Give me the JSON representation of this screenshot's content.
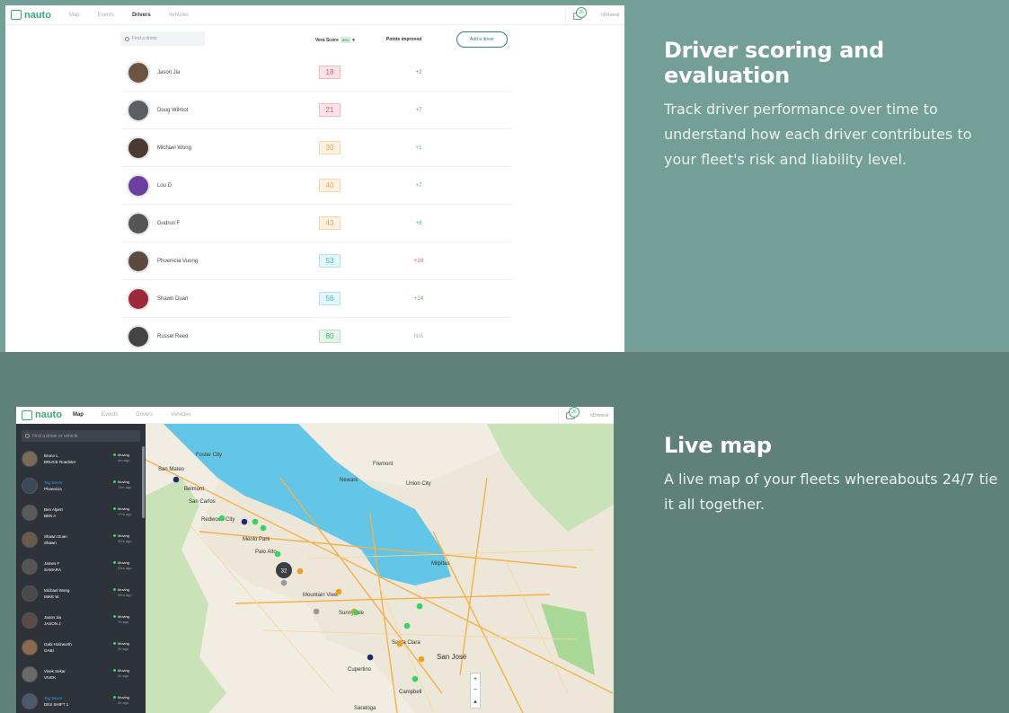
{
  "section1": {
    "heading": "Driver scoring and evaluation",
    "body": "Track driver performance over time to understand how each driver contributes to your fleet's risk and liability level."
  },
  "section2": {
    "heading": "Live map",
    "body": "A live map of your fleets whereabouts 24/7 tie it all together."
  },
  "app": {
    "logo": "nauto",
    "nav": [
      "Map",
      "Events",
      "Drivers",
      "Vehicles"
    ],
    "notification_count": "26",
    "user": "nDriveral"
  },
  "drivers_view": {
    "active_nav": "Drivers",
    "search_placeholder": "Find a driver",
    "col_score": "Vera Score",
    "col_score_badge": "80%",
    "col_points": "Points improved",
    "add_button": "Add a driver",
    "drivers": [
      {
        "name": "Jason Jia",
        "score": "18",
        "points": "+2",
        "tone": "red"
      },
      {
        "name": "Doug Wilmot",
        "score": "21",
        "points": "+7",
        "tone": "red"
      },
      {
        "name": "Michael Wong",
        "score": "30",
        "points": "+1",
        "tone": "orange"
      },
      {
        "name": "Lou D",
        "score": "40",
        "points": "+7",
        "tone": "orange"
      },
      {
        "name": "Gudrun F",
        "score": "43",
        "points": "+8",
        "tone": "orange"
      },
      {
        "name": "Phoenicia Vuong",
        "score": "53",
        "points": "+19",
        "tone": "blue"
      },
      {
        "name": "Shawn Duan",
        "score": "56",
        "points": "+14",
        "tone": "blue"
      },
      {
        "name": "Russel Reed",
        "score": "80",
        "points": "N/A",
        "tone": "green"
      }
    ],
    "tone_colors": {
      "red": {
        "fg": "#e3536b",
        "bg": "#fde4e8",
        "border": "#f6b6c1"
      },
      "orange": {
        "fg": "#f0a04b",
        "bg": "#fff1e2",
        "border": "#f8d3a8"
      },
      "blue": {
        "fg": "#40b5d8",
        "bg": "#e3f6fc",
        "border": "#b2e3f2"
      },
      "green": {
        "fg": "#43b36a",
        "bg": "#e3f5e8",
        "border": "#b7e3c3"
      }
    }
  },
  "map_view": {
    "active_nav": "Map",
    "search_placeholder": "Find a driver or vehicle",
    "vehicles": [
      {
        "name": "Bruno L",
        "code": "BRUCE Roadster",
        "status": "Moving",
        "ago": "4m ago",
        "highlight": false
      },
      {
        "name": "Tag Driver",
        "code": "Phoenicia",
        "status": "Moving",
        "ago": "11m ago",
        "highlight": true
      },
      {
        "name": "Ben Alpert",
        "code": "BEN A",
        "status": "Moving",
        "ago": "17m ago",
        "highlight": false
      },
      {
        "name": "Shawn Duan",
        "code": "Shawn",
        "status": "Moving",
        "ago": "30m ago",
        "highlight": false
      },
      {
        "name": "James F",
        "code": "SAMARA",
        "status": "Moving",
        "ago": "33m ago",
        "highlight": false
      },
      {
        "name": "Michael Wong",
        "code": "MIKE W",
        "status": "Moving",
        "ago": "30m ago",
        "highlight": false
      },
      {
        "name": "Jason Jia",
        "code": "JASON J",
        "status": "Moving",
        "ago": "7h ago",
        "highlight": false
      },
      {
        "name": "Gabi Holzworth",
        "code": "GABI",
        "status": "Moving",
        "ago": "2h ago",
        "highlight": false
      },
      {
        "name": "Vivek Sekar",
        "code": "VIVEK",
        "status": "Moving",
        "ago": "2h ago",
        "highlight": false
      },
      {
        "name": "Tag Driver",
        "code": "DES SHIFT 1",
        "status": "Moving",
        "ago": "2h ago",
        "highlight": true
      }
    ],
    "cities": [
      "Foster City",
      "San Mateo",
      "Belmont",
      "San Carlos",
      "Redwood City",
      "Menlo Park",
      "Palo Alto",
      "Mountain View",
      "Sunnyvale",
      "Santa Clara",
      "San José",
      "Cupertino",
      "Campbell",
      "Saratoga",
      "Fremont",
      "Newark",
      "Milpitas",
      "Union City"
    ],
    "cluster_count": "32",
    "zoom_in": "+",
    "zoom_out": "−"
  }
}
